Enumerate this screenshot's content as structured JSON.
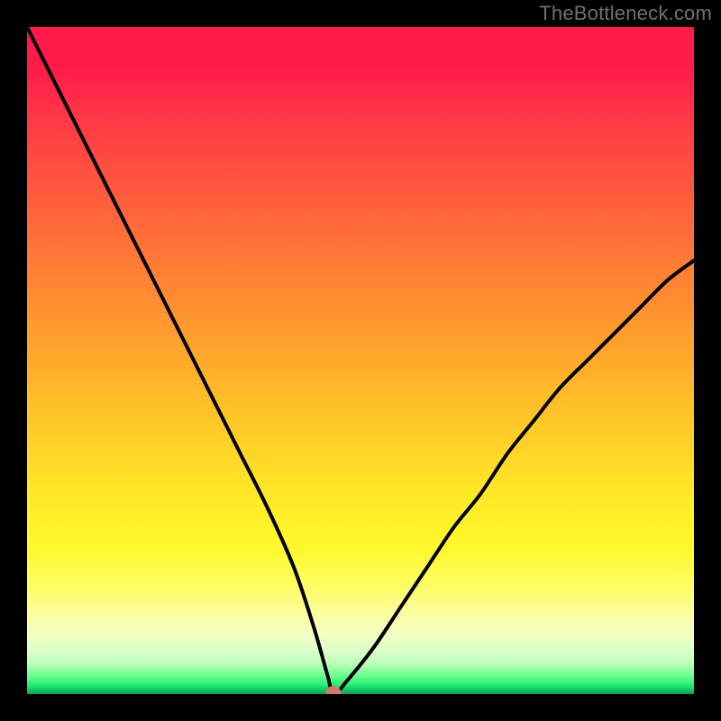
{
  "watermark": "TheBottleneck.com",
  "colors": {
    "curve": "#000000",
    "dot": "#cc7a6a",
    "frame": "#000000"
  },
  "chart_data": {
    "type": "line",
    "title": "",
    "xlabel": "",
    "ylabel": "",
    "xlim": [
      0,
      100
    ],
    "ylim": [
      0,
      100
    ],
    "grid": false,
    "legend": false,
    "comment": "Bottleneck-style V-curve. Axis values are estimated from pixel positions; the minimum (optimal point) sits near x≈46 at y≈0. Left branch falls steeply from top-left; right branch rises more gently to about y≈65 at the right edge.",
    "series": [
      {
        "name": "bottleneck-curve",
        "x": [
          0,
          4,
          8,
          12,
          16,
          20,
          24,
          28,
          32,
          36,
          40,
          43,
          45,
          46,
          48,
          52,
          56,
          60,
          64,
          68,
          72,
          76,
          80,
          84,
          88,
          92,
          96,
          100
        ],
        "y": [
          100,
          92,
          84,
          76,
          68,
          60,
          52,
          44,
          36,
          28,
          19,
          10,
          3,
          0,
          2,
          7,
          13,
          19,
          25,
          30,
          36,
          41,
          46,
          50,
          54,
          58,
          62,
          65
        ]
      }
    ],
    "minimum": {
      "x": 46,
      "y": 0
    }
  }
}
